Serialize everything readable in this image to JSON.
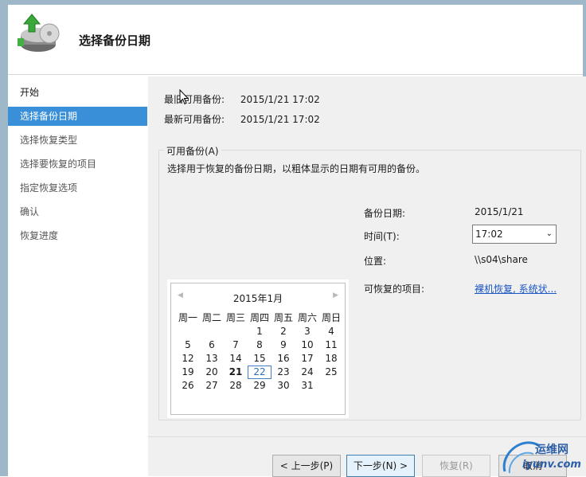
{
  "header": {
    "title": "选择备份日期",
    "icon": "backup-disk-icon"
  },
  "sidebar": {
    "items": [
      {
        "label": "开始",
        "state": "normal"
      },
      {
        "label": "选择备份日期",
        "state": "selected"
      },
      {
        "label": "选择恢复类型",
        "state": "normal"
      },
      {
        "label": "选择要恢复的项目",
        "state": "normal"
      },
      {
        "label": "指定恢复选项",
        "state": "normal"
      },
      {
        "label": "确认",
        "state": "normal"
      },
      {
        "label": "恢复进度",
        "state": "normal"
      }
    ]
  },
  "main": {
    "oldest_label": "最旧可用备份:",
    "oldest_value": "2015/1/21 17:02",
    "newest_label": "最新可用备份:",
    "newest_value": "2015/1/21 17:02",
    "group_label": "可用备份(A)",
    "group_description": "选择用于恢复的备份日期，以粗体显示的日期有可用的备份。",
    "calendar": {
      "month_label": "2015年1月",
      "prev_icon": "chevron-left-icon",
      "next_icon": "chevron-right-icon",
      "weekdays": [
        "周一",
        "周二",
        "周三",
        "周四",
        "周五",
        "周六",
        "周日"
      ],
      "leading_blanks": 3,
      "days": [
        "1",
        "2",
        "3",
        "4",
        "5",
        "6",
        "7",
        "8",
        "9",
        "10",
        "11",
        "12",
        "13",
        "14",
        "15",
        "16",
        "17",
        "18",
        "19",
        "20",
        "21",
        "22",
        "23",
        "24",
        "25",
        "26",
        "27",
        "28",
        "29",
        "30",
        "31"
      ],
      "bold_day": "21",
      "today": "22"
    },
    "details": {
      "date_label": "备份日期:",
      "date_value": "2015/1/21",
      "time_label": "时间(T):",
      "time_value": "17:02",
      "location_label": "位置:",
      "location_value": "\\\\s04\\share",
      "items_label": "可恢复的项目:",
      "items_link": "裸机恢复, 系统状..."
    }
  },
  "footer": {
    "back_label": "< 上一步(P)",
    "next_label": "下一步(N) >",
    "recover_label": "恢复(R)",
    "cancel_label": "取消"
  },
  "watermark": {
    "line1": "运维网",
    "line2": "iyunv.com"
  },
  "colors": {
    "selection": "#3a90d8",
    "link": "#1a55c4",
    "content_bg": "#f0f0f0"
  }
}
